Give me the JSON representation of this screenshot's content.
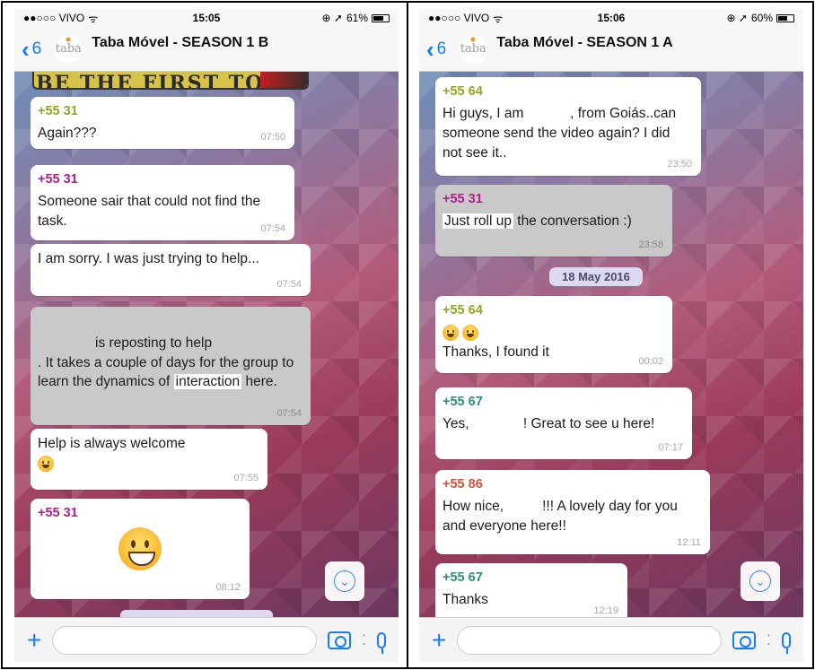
{
  "left_phone": {
    "status": {
      "carrier": "●●○○○ VIVO",
      "wifi": "ᯤ",
      "time": "15:05",
      "right_icons": "⊕ ➚",
      "battery": "61%",
      "battery_fraction": 0.61
    },
    "header": {
      "back_count": "6",
      "avatar_text": "taba",
      "title": "Taba Móvel - SEASON 1 B"
    },
    "banner_text": "BE THE FIRST TO SPEAK OUT!",
    "messages": [
      {
        "sender": "+55 31",
        "text": "Again???",
        "time": "07:50"
      },
      {
        "sender": "+55 31",
        "text": "Someone sair that could not find the task.",
        "time": "07:54"
      },
      {
        "text": "I am sorry. I was just trying to help...",
        "time": "07:54"
      },
      {
        "text_a": "is reposting to help",
        "text_b": ". It takes a couple of days for the group to learn   the dynamics of",
        "text_hl": "interaction",
        "text_c": " here.",
        "time": "07:54"
      },
      {
        "text": "Help is always welcome",
        "time": "07:55"
      },
      {
        "sender": "+55 31",
        "time": "08:12"
      }
    ],
    "input": {
      "placeholder": ""
    }
  },
  "right_phone": {
    "status": {
      "carrier": "●●○○○ VIVO",
      "wifi": "ᯤ",
      "time": "15:06",
      "right_icons": "⊕ ➚",
      "battery": "60%",
      "battery_fraction": 0.6
    },
    "header": {
      "back_count": "6",
      "avatar_text": "taba",
      "title": "Taba Móvel - SEASON 1 A"
    },
    "messages": [
      {
        "sender": "+55 64",
        "text": "Hi guys, I am            , from Goiás..can someone send the video again? I did not see it..",
        "time": "23:50"
      },
      {
        "sender": "+55 31",
        "text_hl": "Just roll up",
        "text": " the conversation :)",
        "time": "23:58"
      },
      {
        "sender": "+55 64",
        "text": "Thanks, I found it",
        "time": "00:02"
      },
      {
        "sender": "+55 67",
        "text": "Yes,              ! Great to see u here!",
        "time": "07:17"
      },
      {
        "sender": "+55 86",
        "text": "How nice,          !!! A lovely day for you and everyone here!!",
        "time": "12:11"
      },
      {
        "sender": "+55 67",
        "text": "Thanks",
        "time": "12:19"
      }
    ],
    "date_pill": "18 May 2016",
    "input": {
      "placeholder": ""
    }
  },
  "colors": {
    "ios_blue": "#1a7cf5",
    "sender_31": "#b0208c",
    "sender_64": "#8fa81f",
    "sender_67": "#2f8f7a",
    "sender_86": "#d4533a",
    "grey_bubble": "#c9c9c9"
  }
}
